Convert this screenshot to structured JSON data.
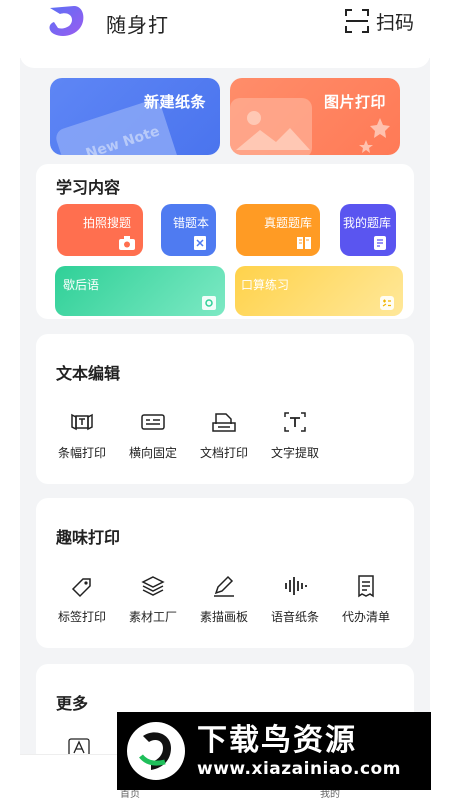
{
  "header": {
    "title": "随身打",
    "scan_label": "扫码"
  },
  "actions": {
    "new_note": "新建纸条",
    "new_note_art": "New Note",
    "photo_print": "图片打印"
  },
  "learning": {
    "title": "学习内容",
    "tiles": [
      {
        "label": "拍照搜题",
        "icon": "camera-icon",
        "color": "#ff6f4f"
      },
      {
        "label": "错题本",
        "icon": "notebook-x-icon",
        "color": "#4f7bf1"
      },
      {
        "label": "真题题库",
        "icon": "book-icon",
        "color": "#ff9b24"
      },
      {
        "label": "我的题库",
        "icon": "document-icon",
        "color": "#5a55f0"
      },
      {
        "label": "歇后语",
        "icon": "tag-icon",
        "color": "#2fd097"
      },
      {
        "label": "口算练习",
        "icon": "calculator-icon",
        "color": "#ffd24a"
      }
    ]
  },
  "text_edit": {
    "title": "文本编辑",
    "items": [
      {
        "label": "条幅打印",
        "icon": "banner-icon"
      },
      {
        "label": "横向固定",
        "icon": "horizontal-text-icon"
      },
      {
        "label": "文档打印",
        "icon": "document-print-icon"
      },
      {
        "label": "文字提取",
        "icon": "text-extract-icon"
      }
    ]
  },
  "fun_print": {
    "title": "趣味打印",
    "items": [
      {
        "label": "标签打印",
        "icon": "label-tag-icon"
      },
      {
        "label": "素材工厂",
        "icon": "layers-icon"
      },
      {
        "label": "素描画板",
        "icon": "pencil-icon"
      },
      {
        "label": "语音纸条",
        "icon": "voice-wave-icon"
      },
      {
        "label": "代办清单",
        "icon": "checklist-icon"
      }
    ]
  },
  "more": {
    "title": "更多"
  },
  "bottom_nav": {
    "home": "首页",
    "mine": "我的"
  },
  "watermark": {
    "name": "下载鸟资源",
    "url": "www.xiazainiao.com"
  },
  "colors": {
    "accent_blue": "#4f7bf1",
    "accent_orange": "#ff7a56"
  }
}
